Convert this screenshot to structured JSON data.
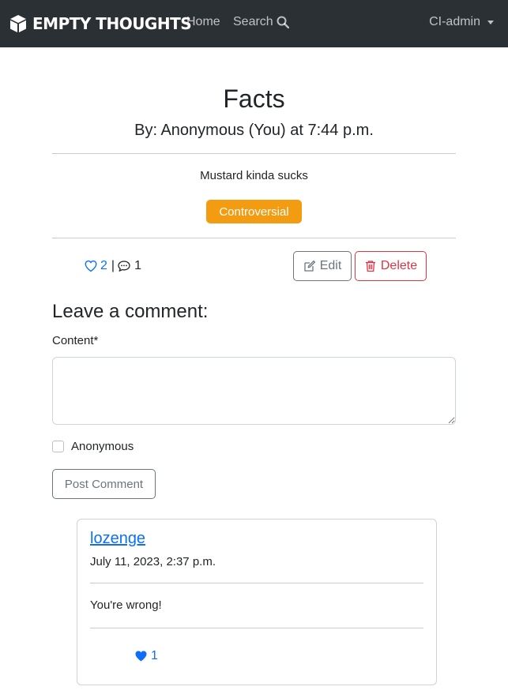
{
  "navbar": {
    "brand": "EMPTY THOUGHTS",
    "brand_icon": "cube-icon",
    "links": [
      {
        "label": "Home"
      },
      {
        "label": "Search",
        "icon": "search-icon"
      }
    ],
    "user_menu": {
      "label": "CI-admin",
      "icon": "caret-down-icon"
    }
  },
  "post": {
    "title": "Facts",
    "byline": "By: Anonymous (You) at 7:44 p.m.",
    "content": "Mustard kinda sucks",
    "tag": {
      "label": "Controversial",
      "color": "#f39c12"
    },
    "likes": "2",
    "separator": "|",
    "comments": "1",
    "actions": {
      "edit_label": "Edit",
      "delete_label": "Delete"
    }
  },
  "comment_form": {
    "heading": "Leave a comment:",
    "content_label": "Content*",
    "content_value": "",
    "anonymous_label": "Anonymous",
    "anonymous_checked": false,
    "submit_label": "Post Comment"
  },
  "comments": [
    {
      "author": "lozenge",
      "date": "July 11, 2023, 2:37 p.m.",
      "body": "You're wrong!",
      "likes": "1",
      "liked": true
    }
  ],
  "colors": {
    "navbar_bg": "#2b3035",
    "link": "#0d6efd",
    "warning": "#f39c12",
    "danger": "#dc3545",
    "secondary": "#6c757d"
  }
}
